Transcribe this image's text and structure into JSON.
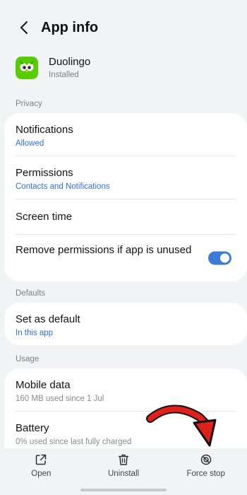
{
  "header": {
    "title": "App info"
  },
  "app": {
    "name": "Duolingo",
    "status": "Installed"
  },
  "sections": {
    "privacy": "Privacy",
    "defaults": "Defaults",
    "usage": "Usage"
  },
  "privacy_rows": {
    "notifications": {
      "title": "Notifications",
      "sub": "Allowed"
    },
    "permissions": {
      "title": "Permissions",
      "sub": "Contacts and Notifications"
    },
    "screen_time": {
      "title": "Screen time"
    },
    "remove_permissions": {
      "title": "Remove permissions if app is unused",
      "toggle_on": true
    }
  },
  "defaults_rows": {
    "set_default": {
      "title": "Set as default",
      "sub": "In this app"
    }
  },
  "usage_rows": {
    "mobile_data": {
      "title": "Mobile data",
      "sub": "160 MB used since 1 Jul"
    },
    "battery": {
      "title": "Battery",
      "sub": "0% used since last fully charged"
    }
  },
  "actions": {
    "open": {
      "label": "Open",
      "icon": "open-external-icon"
    },
    "uninstall": {
      "label": "Uninstall",
      "icon": "trash-icon"
    },
    "force_stop": {
      "label": "Force stop",
      "icon": "block-icon"
    }
  },
  "colors": {
    "accent": "#3d7bd9",
    "link": "#2f6fd6",
    "annotation_arrow": "#e0201b"
  }
}
